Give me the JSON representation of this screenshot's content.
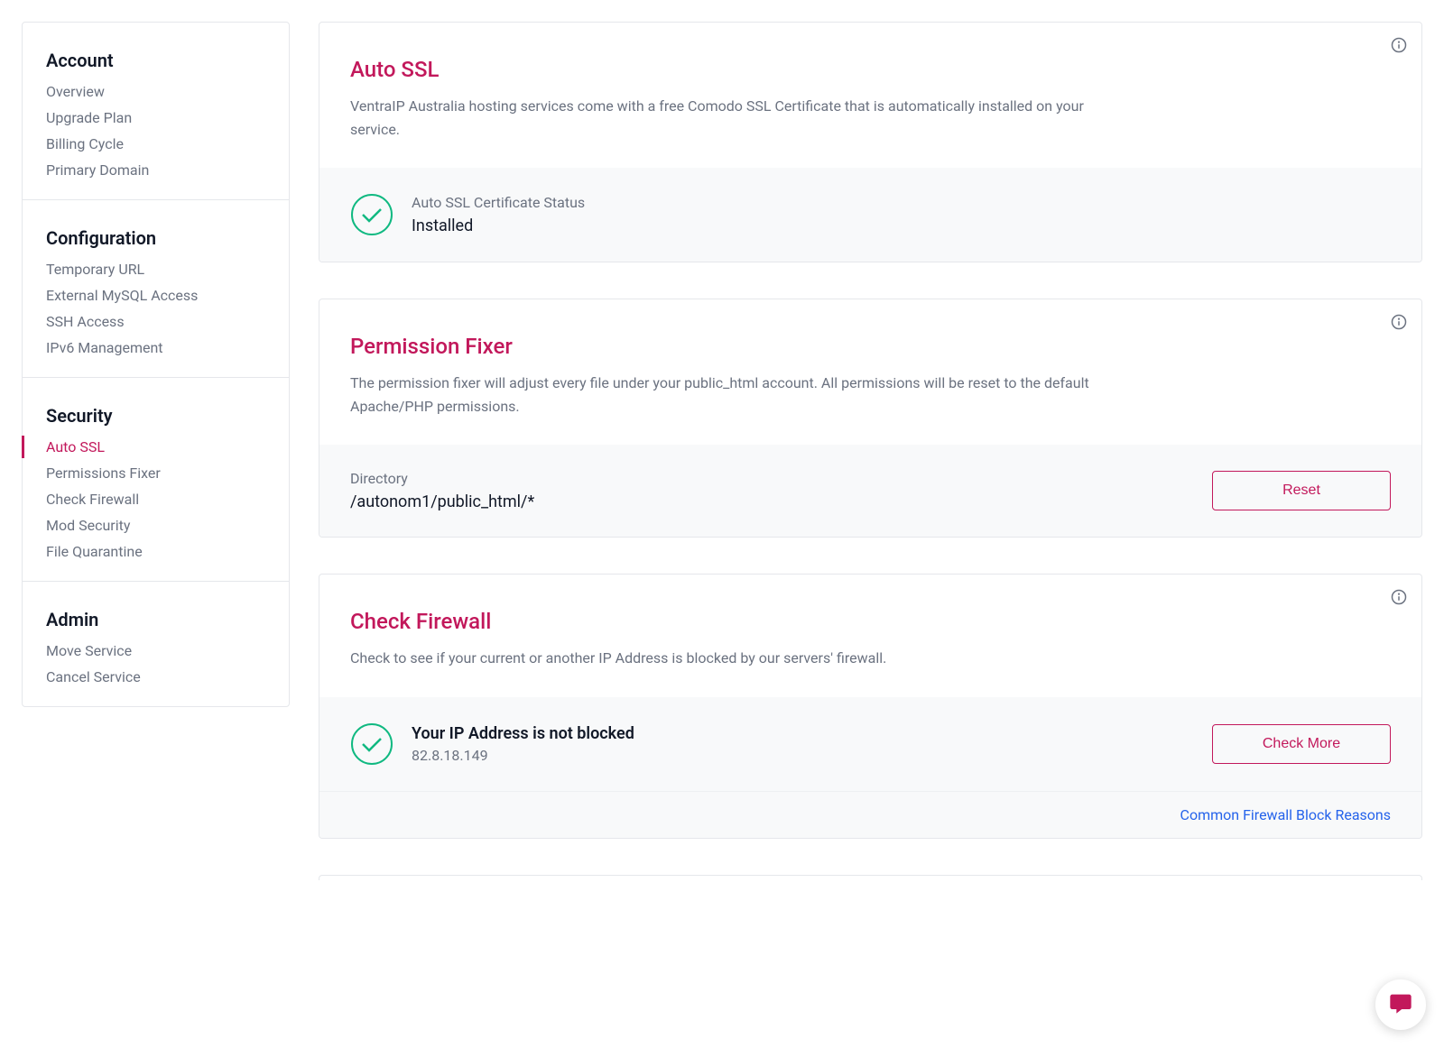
{
  "sidebar": {
    "sections": [
      {
        "heading": "Account",
        "items": [
          {
            "label": "Overview",
            "active": false
          },
          {
            "label": "Upgrade Plan",
            "active": false
          },
          {
            "label": "Billing Cycle",
            "active": false
          },
          {
            "label": "Primary Domain",
            "active": false
          }
        ]
      },
      {
        "heading": "Configuration",
        "items": [
          {
            "label": "Temporary URL",
            "active": false
          },
          {
            "label": "External MySQL Access",
            "active": false
          },
          {
            "label": "SSH Access",
            "active": false
          },
          {
            "label": "IPv6 Management",
            "active": false
          }
        ]
      },
      {
        "heading": "Security",
        "items": [
          {
            "label": "Auto SSL",
            "active": true
          },
          {
            "label": "Permissions Fixer",
            "active": false
          },
          {
            "label": "Check Firewall",
            "active": false
          },
          {
            "label": "Mod Security",
            "active": false
          },
          {
            "label": "File Quarantine",
            "active": false
          }
        ]
      },
      {
        "heading": "Admin",
        "items": [
          {
            "label": "Move Service",
            "active": false
          },
          {
            "label": "Cancel Service",
            "active": false
          }
        ]
      }
    ]
  },
  "autossl": {
    "title": "Auto SSL",
    "desc": "VentraIP Australia hosting services come with a free Comodo SSL Certificate that is automatically installed on your service.",
    "status_label": "Auto SSL Certificate Status",
    "status_value": "Installed"
  },
  "permfixer": {
    "title": "Permission Fixer",
    "desc": "The permission fixer will adjust every file under your public_html account. All permissions will be reset to the default Apache/PHP permissions.",
    "field_label": "Directory",
    "field_value": "/autonom1/public_html/*",
    "reset_label": "Reset"
  },
  "firewall": {
    "title": "Check Firewall",
    "desc": "Check to see if your current or another IP Address is blocked by our servers' firewall.",
    "status_value": "Your IP Address is not blocked",
    "status_sub": "82.8.18.149",
    "check_more_label": "Check More",
    "footer_link": "Common Firewall Block Reasons"
  },
  "icons": {
    "info": "info-icon",
    "check": "check-circle-icon",
    "chat": "chat-icon"
  }
}
